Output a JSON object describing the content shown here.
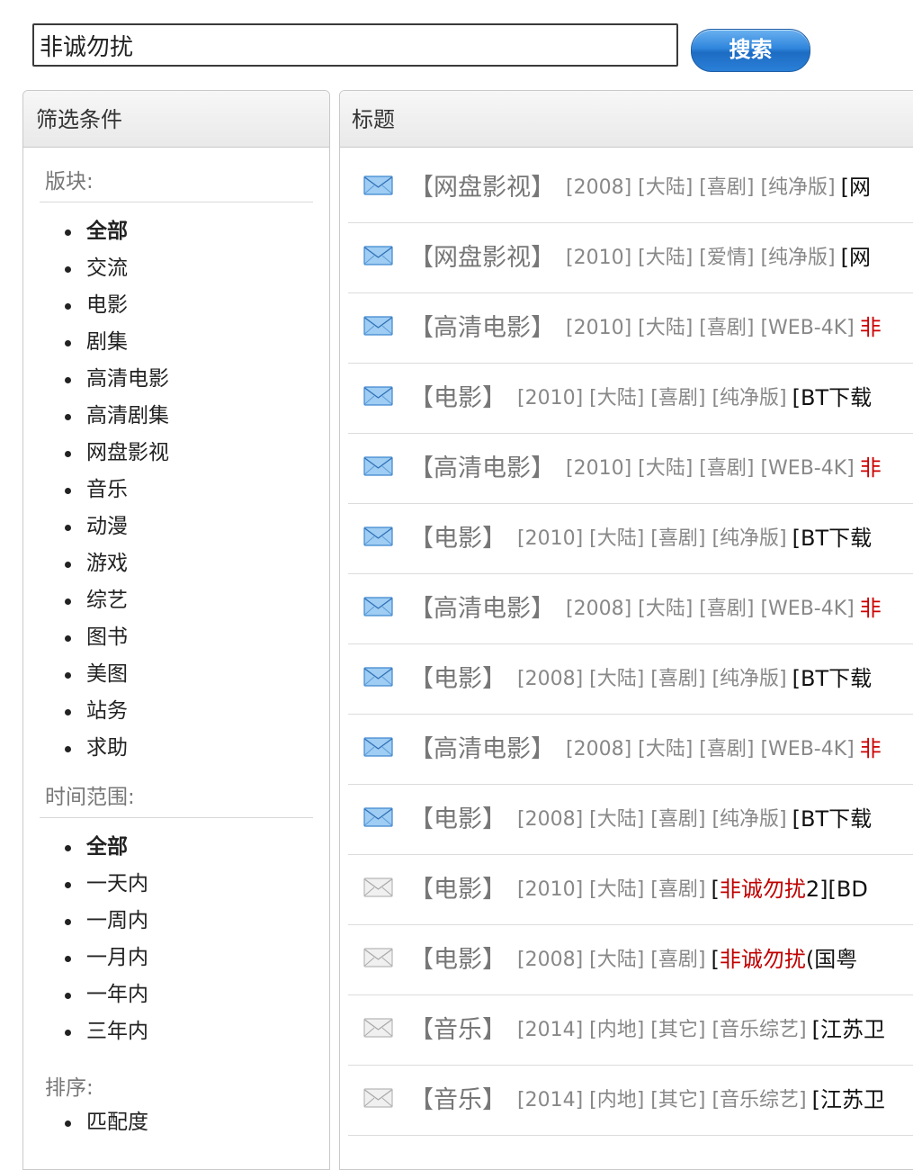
{
  "search": {
    "value": "非诚勿扰",
    "button_label": "搜索"
  },
  "filter_panel": {
    "header": "筛选条件",
    "board_title": "版块:",
    "board_items": [
      "全部",
      "交流",
      "电影",
      "剧集",
      "高清电影",
      "高清剧集",
      "网盘影视",
      "音乐",
      "动漫",
      "游戏",
      "综艺",
      "图书",
      "美图",
      "站务",
      "求助"
    ],
    "board_active": "全部",
    "time_title": "时间范围:",
    "time_items": [
      "全部",
      "一天内",
      "一周内",
      "一月内",
      "一年内",
      "三年内"
    ],
    "time_active": "全部",
    "sort_title": "排序:",
    "sort_items": [
      "匹配度"
    ]
  },
  "results_panel": {
    "header": "标题",
    "rows": [
      {
        "icon": "mail-blue-icon",
        "category": "【网盘影视】",
        "tags": "[2008] [大陆] [喜剧] [纯净版]",
        "title_prefix": "[网",
        "title_hl": "",
        "title_suffix": ""
      },
      {
        "icon": "mail-blue-icon",
        "category": "【网盘影视】",
        "tags": "[2010] [大陆] [爱情] [纯净版]",
        "title_prefix": "[网",
        "title_hl": "",
        "title_suffix": ""
      },
      {
        "icon": "mail-blue-icon",
        "category": "【高清电影】",
        "tags": "[2010] [大陆] [喜剧] [WEB-4K]",
        "title_prefix": "",
        "title_hl": "",
        "title_suffix": "",
        "title_red": "非"
      },
      {
        "icon": "mail-blue-icon",
        "category": "【电影】",
        "tags": "[2010] [大陆] [喜剧] [纯净版]",
        "title_prefix": "[BT下载",
        "title_hl": "",
        "title_suffix": ""
      },
      {
        "icon": "mail-blue-icon",
        "category": "【高清电影】",
        "tags": "[2010] [大陆] [喜剧] [WEB-4K]",
        "title_prefix": "",
        "title_hl": "",
        "title_suffix": "",
        "title_red": "非"
      },
      {
        "icon": "mail-blue-icon",
        "category": "【电影】",
        "tags": "[2010] [大陆] [喜剧] [纯净版]",
        "title_prefix": "[BT下载",
        "title_hl": "",
        "title_suffix": ""
      },
      {
        "icon": "mail-blue-icon",
        "category": "【高清电影】",
        "tags": "[2008] [大陆] [喜剧] [WEB-4K]",
        "title_prefix": "",
        "title_hl": "",
        "title_suffix": "",
        "title_red": "非"
      },
      {
        "icon": "mail-blue-icon",
        "category": "【电影】",
        "tags": "[2008] [大陆] [喜剧] [纯净版]",
        "title_prefix": "[BT下载",
        "title_hl": "",
        "title_suffix": ""
      },
      {
        "icon": "mail-blue-icon",
        "category": "【高清电影】",
        "tags": "[2008] [大陆] [喜剧] [WEB-4K]",
        "title_prefix": "",
        "title_hl": "",
        "title_suffix": "",
        "title_red": "非"
      },
      {
        "icon": "mail-blue-icon",
        "category": "【电影】",
        "tags": "[2008] [大陆] [喜剧] [纯净版]",
        "title_prefix": "[BT下载",
        "title_hl": "",
        "title_suffix": ""
      },
      {
        "icon": "mail-gray-icon",
        "category": "【电影】",
        "tags": "[2010] [大陆] [喜剧]",
        "title_prefix": "[",
        "title_hl": "非诚勿扰",
        "title_suffix": "2][BD"
      },
      {
        "icon": "mail-gray-icon",
        "category": "【电影】",
        "tags": "[2008] [大陆] [喜剧]",
        "title_prefix": "[",
        "title_hl": "非诚勿扰",
        "title_suffix": "(国粤"
      },
      {
        "icon": "mail-gray-icon",
        "category": "【音乐】",
        "tags": "[2014] [内地] [其它] [音乐综艺]",
        "title_prefix": "[江苏卫",
        "title_hl": "",
        "title_suffix": ""
      },
      {
        "icon": "mail-gray-icon",
        "category": "【音乐】",
        "tags": "[2014] [内地] [其它] [音乐综艺]",
        "title_prefix": "[江苏卫",
        "title_hl": "",
        "title_suffix": ""
      }
    ]
  },
  "colors": {
    "highlight": "#c00000",
    "button_blue": "#2f86dc",
    "tag_gray": "#888888"
  }
}
